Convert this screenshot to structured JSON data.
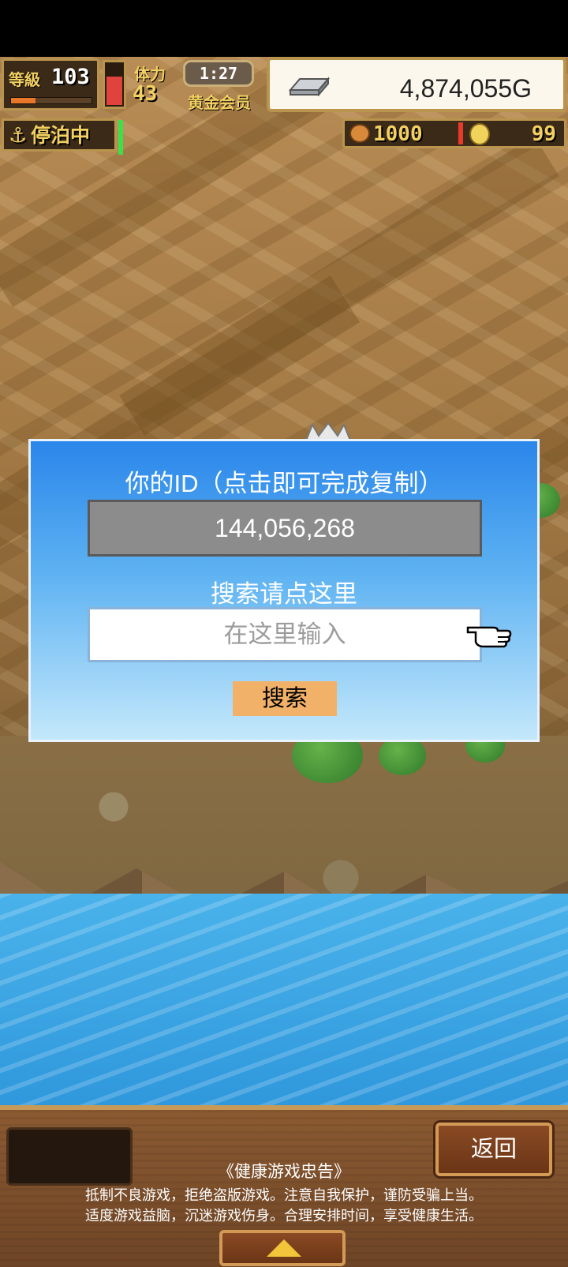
{
  "hud": {
    "level_label": "等級",
    "level_value": "103",
    "xp_fraction": 0.3,
    "stamina_label": "体力",
    "stamina_value": "43",
    "stamina_fraction": 0.7,
    "timer": "1:27",
    "membership": "黄金会员",
    "money": "4,874,055G",
    "docked_label": "停泊中",
    "food_value": "1000",
    "coin_value": "99"
  },
  "dialog": {
    "title": "你的ID（点击即可完成复制）",
    "id_value": "144,056,268",
    "search_title": "搜索请点这里",
    "search_placeholder": "在这里输入",
    "search_button": "搜索"
  },
  "bottom": {
    "back_button": "返回",
    "notice_title": "《健康游戏忠告》",
    "notice_line1": "抵制不良游戏，拒绝盗版游戏。注意自我保护，谨防受骗上当。",
    "notice_line2": "适度游戏益脑，沉迷游戏伤身。合理安排时间，享受健康生活。"
  },
  "icons": {
    "anchor": "anchor-icon",
    "silver_bar": "silver-bar-icon",
    "food": "food-icon",
    "coin": "coin-icon",
    "pointer": "pointing-hand-icon",
    "expand": "arrow-up-icon"
  },
  "colors": {
    "dialog_top": "#2a86ea",
    "dialog_bottom": "#c4e8fb",
    "search_button": "#f2b168",
    "hud_gold": "#f2d061",
    "panel_wood": "#8b5a32"
  }
}
